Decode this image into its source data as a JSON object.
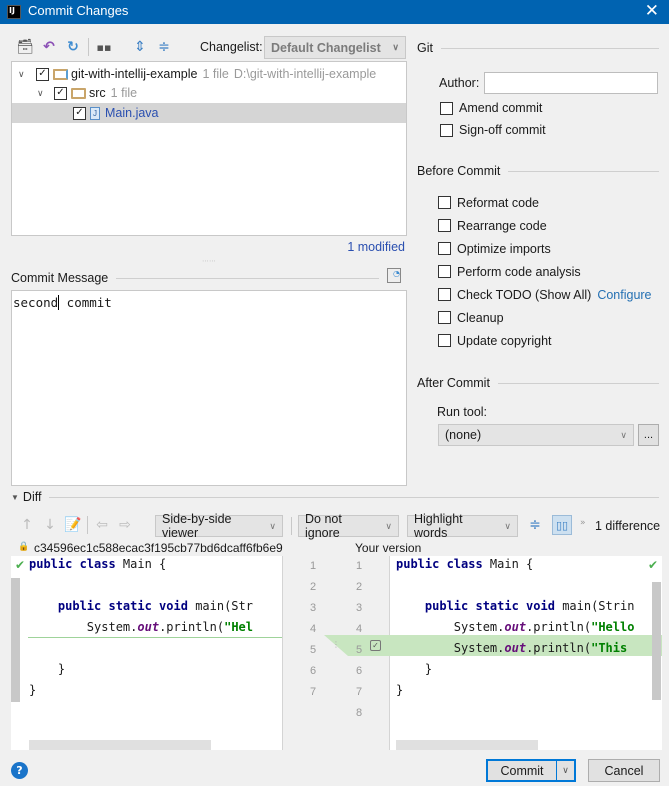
{
  "window": {
    "title": "Commit Changes",
    "app_icon": "IJ"
  },
  "toolbar": {
    "icons": [
      "show-diff-icon",
      "rollback-icon",
      "refresh-icon",
      "group-by-icon",
      "expand-all-icon",
      "collapse-all-icon"
    ],
    "changelist_label": "Changelist:",
    "changelist_value": "Default Changelist"
  },
  "tree": {
    "root": {
      "name": "git-with-intellij-example",
      "count": "1 file",
      "path": "D:\\git-with-intellij-example",
      "checked": true
    },
    "folder": {
      "name": "src",
      "count": "1 file",
      "checked": true
    },
    "file": {
      "name": "Main.java",
      "checked": true
    },
    "status": "1 modified"
  },
  "commit_message": {
    "label": "Commit Message",
    "value_before_cursor": "second",
    "value_after_cursor": " commit"
  },
  "git": {
    "title": "Git",
    "author_label": "Author:",
    "author_value": "",
    "amend_label": "Amend commit",
    "signoff_label": "Sign-off commit"
  },
  "before_commit": {
    "title": "Before Commit",
    "options": [
      {
        "label": "Reformat code",
        "checked": false
      },
      {
        "label": "Rearrange code",
        "checked": false
      },
      {
        "label": "Optimize imports",
        "checked": false
      },
      {
        "label": "Perform code analysis",
        "checked": false
      },
      {
        "label": "Check TODO (Show All)",
        "checked": false,
        "link": "Configure"
      },
      {
        "label": "Cleanup",
        "checked": false
      },
      {
        "label": "Update copyright",
        "checked": false
      }
    ]
  },
  "after_commit": {
    "title": "After Commit",
    "run_tool_label": "Run tool:",
    "run_tool_value": "(none)",
    "browse_label": "..."
  },
  "diff": {
    "title": "Diff",
    "viewer": "Side-by-side viewer",
    "ignore": "Do not ignore",
    "highlight": "Highlight words",
    "count": "1 difference",
    "left_header": "c34596ec1c588ecac3f195cb77bd6dcaff6fb6e9",
    "right_header": "Your version",
    "left_numbers": [
      "1",
      "2",
      "3",
      "4",
      "5",
      "6",
      "7"
    ],
    "right_numbers": [
      "1",
      "2",
      "3",
      "4",
      "5",
      "6",
      "7",
      "8"
    ],
    "left_lines": [
      [
        [
          "kw",
          "public class "
        ],
        [
          "",
          "Main {"
        ]
      ],
      [],
      [
        [
          "",
          "    "
        ],
        [
          "kw",
          "public static void "
        ],
        [
          "",
          "main(Str"
        ]
      ],
      [
        [
          "",
          "        System."
        ],
        [
          "it",
          "out"
        ],
        [
          "",
          ".println("
        ],
        [
          "str",
          "\"Hel"
        ]
      ],
      [
        [
          "",
          "    }"
        ]
      ],
      [
        [
          "",
          "}"
        ]
      ]
    ],
    "right_lines": [
      [
        [
          "kw",
          "public class "
        ],
        [
          "",
          "Main {"
        ]
      ],
      [],
      [
        [
          "",
          "    "
        ],
        [
          "kw",
          "public static void "
        ],
        [
          "",
          "main(Strin"
        ]
      ],
      [
        [
          "",
          "        System."
        ],
        [
          "it",
          "out"
        ],
        [
          "",
          ".println("
        ],
        [
          "str",
          "\"Hello"
        ]
      ],
      [
        [
          "",
          "        System."
        ],
        [
          "it",
          "out"
        ],
        [
          "",
          ".println("
        ],
        [
          "str",
          "\"This"
        ]
      ],
      [
        [
          "",
          "    }"
        ]
      ],
      [
        [
          "",
          "}"
        ]
      ],
      []
    ]
  },
  "footer": {
    "commit_label": "Commit",
    "cancel_label": "Cancel",
    "help": "?"
  },
  "colors": {
    "titlebar": "#0063b1",
    "added": "#c8e6c0",
    "link": "#2470b3"
  }
}
